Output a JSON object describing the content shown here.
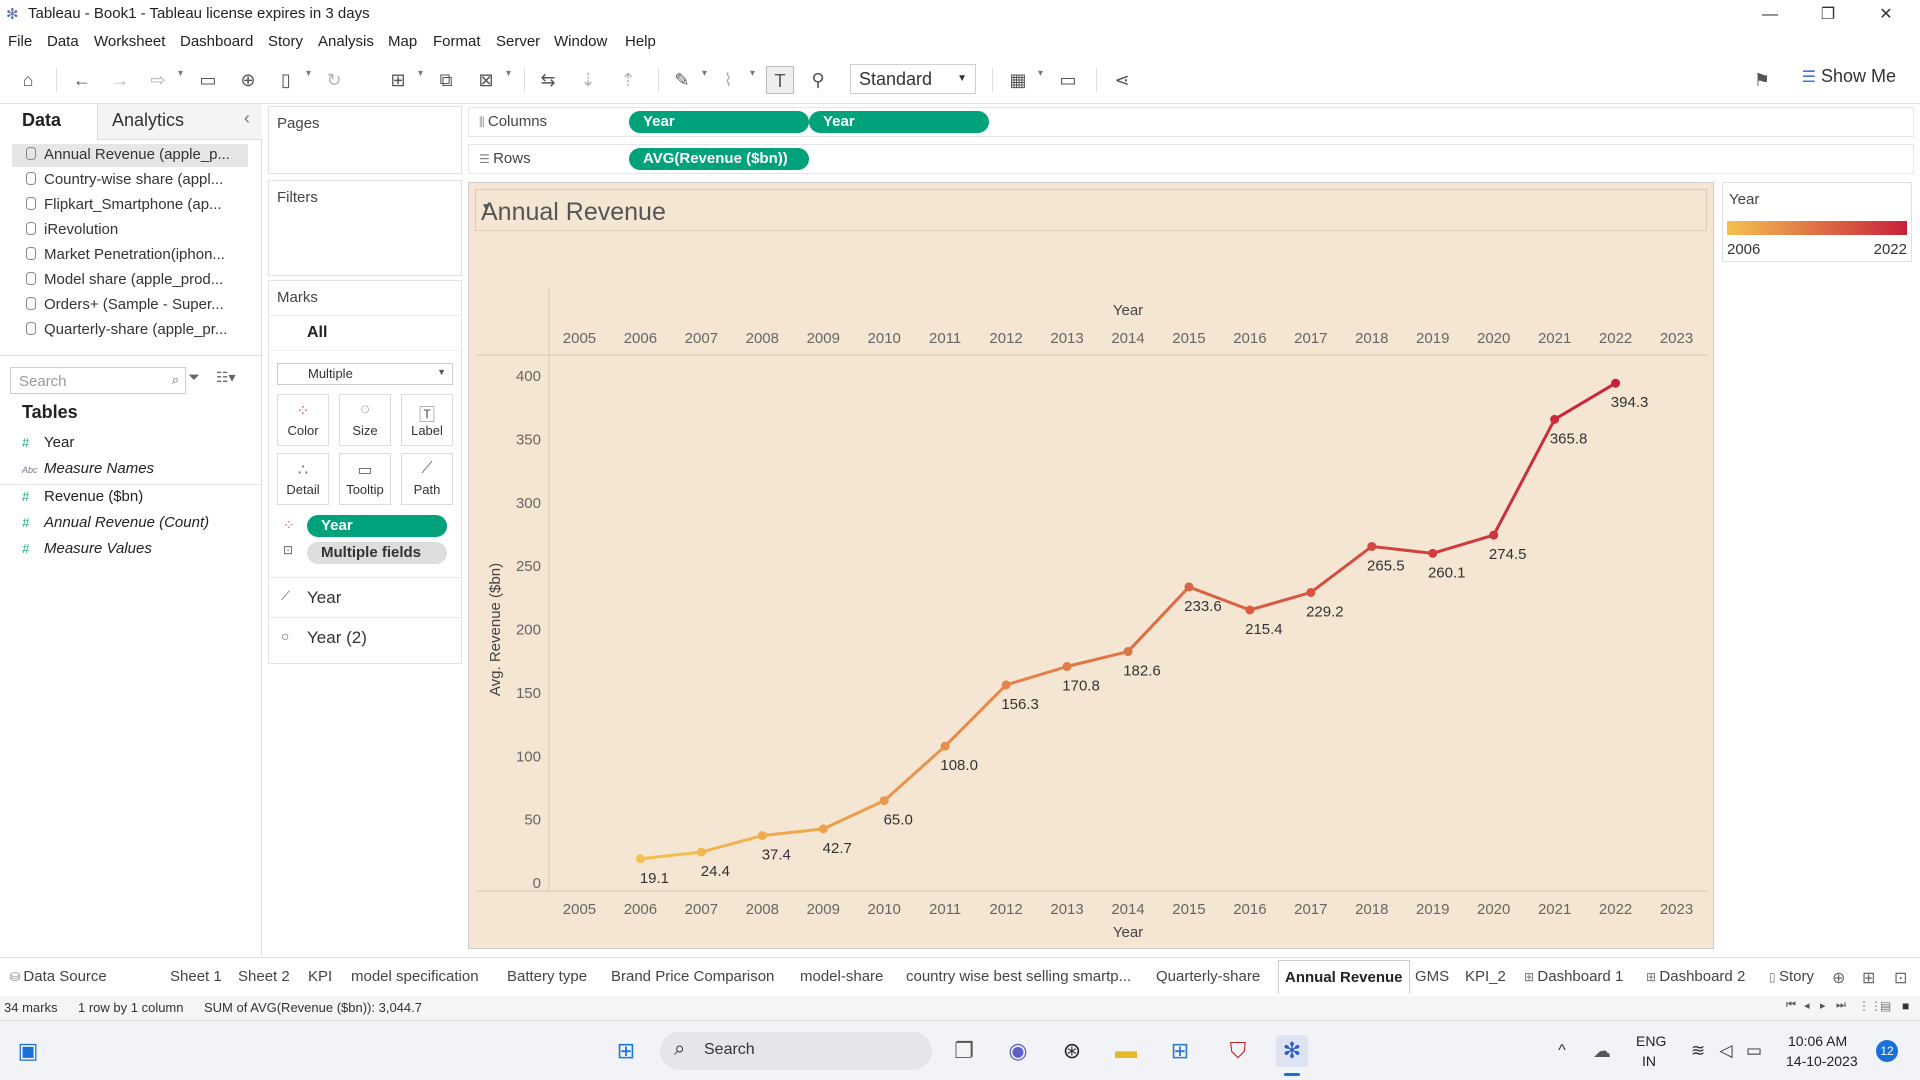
{
  "window": {
    "title": "Tableau - Book1 - Tableau license expires in 3 days",
    "minimize": "—",
    "restore": "❐",
    "close": "✕"
  },
  "menu": [
    "File",
    "Data",
    "Worksheet",
    "Dashboard",
    "Story",
    "Analysis",
    "Map",
    "Format",
    "Server",
    "Window",
    "Help"
  ],
  "toolbar": {
    "fit_select": "Standard",
    "show_me": "Show Me"
  },
  "left_panel": {
    "tab_data": "Data",
    "tab_analytics": "Analytics",
    "collapse": "‹",
    "data_sources": [
      "Annual Revenue (apple_p...",
      "Country-wise share (appl...",
      "Flipkart_Smartphone (ap...",
      "iRevolution",
      "Market Penetration(iphon...",
      "Model share (apple_prod...",
      "Orders+ (Sample - Super...",
      "Quarterly-share (apple_pr..."
    ],
    "search_placeholder": "Search",
    "tables_heading": "Tables",
    "fields": {
      "year": "Year",
      "measure_names": "Measure Names",
      "revenue": "Revenue ($bn)",
      "count": "Annual Revenue (Count)",
      "measure_values": "Measure Values"
    },
    "abc_label": "Abc"
  },
  "cards": {
    "pages": "Pages",
    "filters": "Filters",
    "marks": "Marks",
    "all": "All",
    "mark_type": "Multiple",
    "buttons": {
      "color": "Color",
      "size": "Size",
      "label": "Label",
      "detail": "Detail",
      "tooltip": "Tooltip",
      "path": "Path"
    },
    "pills": {
      "year": "Year",
      "multiple": "Multiple fields"
    },
    "layers": {
      "line": "Year",
      "circle": "Year (2)"
    }
  },
  "shelves": {
    "columns_label": "Columns",
    "rows_label": "Rows",
    "columns": [
      "Year",
      "Year"
    ],
    "rows": [
      "AVG(Revenue ($bn))"
    ]
  },
  "viz": {
    "title": "Annual Revenue"
  },
  "legend": {
    "title": "Year",
    "min": "2006",
    "max": "2022",
    "color_low": "#f5c151",
    "color_high": "#c8203a"
  },
  "chart_data": {
    "type": "line",
    "title": "Annual Revenue",
    "xlabel": "Year",
    "ylabel": "Avg. Revenue ($bn)",
    "x_ticks": [
      "2005",
      "2006",
      "2007",
      "2008",
      "2009",
      "2010",
      "2011",
      "2012",
      "2013",
      "2014",
      "2015",
      "2016",
      "2017",
      "2018",
      "2019",
      "2020",
      "2021",
      "2022",
      "2023"
    ],
    "y_ticks": [
      0,
      50,
      100,
      150,
      200,
      250,
      300,
      350,
      400
    ],
    "xlim": [
      2005,
      2023
    ],
    "ylim": [
      0,
      400
    ],
    "x": [
      2006,
      2007,
      2008,
      2009,
      2010,
      2011,
      2012,
      2013,
      2014,
      2015,
      2016,
      2017,
      2018,
      2019,
      2020,
      2021,
      2022
    ],
    "values": [
      19.1,
      24.4,
      37.4,
      42.7,
      65.0,
      108.0,
      156.3,
      170.8,
      182.6,
      233.6,
      215.4,
      229.2,
      265.5,
      260.1,
      274.5,
      365.8,
      394.3
    ],
    "labels": [
      "19.1",
      "24.4",
      "37.4",
      "42.7",
      "65.0",
      "108.0",
      "156.3",
      "170.8",
      "182.6",
      "233.6",
      "215.4",
      "229.2",
      "265.5",
      "260.1",
      "274.5",
      "365.8",
      "394.3"
    ],
    "color_low": "#f5c151",
    "color_high": "#c8203a",
    "background": "#f5e6d3",
    "grid": false
  },
  "sheets": [
    "Data Source",
    "Sheet 1",
    "Sheet 2",
    "KPI",
    "model specification",
    "Battery type",
    "Brand Price Comparison",
    "model-share",
    "country wise best selling smartp...",
    "Quarterly-share",
    "Annual Revenue",
    "GMS",
    "KPI_2",
    "Dashboard 1",
    "Dashboard 2",
    "Story"
  ],
  "active_sheet": "Annual Revenue",
  "status": {
    "marks": "34 marks",
    "dims": "1 row by 1 column",
    "sum": "SUM of AVG(Revenue ($bn)): 3,044.7"
  },
  "taskbar": {
    "search": "Search",
    "lang1": "ENG",
    "lang2": "IN",
    "time": "10:06 AM",
    "date": "14-10-2023",
    "badge": "12"
  }
}
